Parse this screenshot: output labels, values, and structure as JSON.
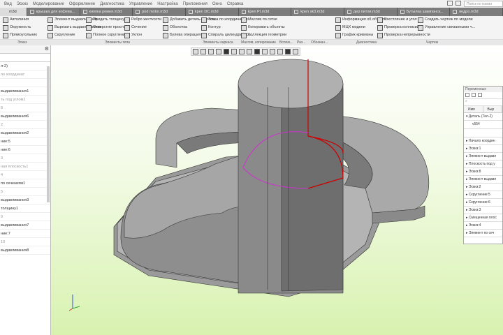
{
  "menu": [
    "Вид",
    "Эскиз",
    "Моделирование",
    "Оформление",
    "Диагностика",
    "Управление",
    "Настройка",
    "Приложения",
    "Окно",
    "Справка"
  ],
  "search_placeholder": "Поиск по коман",
  "tabs": [
    {
      "label": "m3d"
    },
    {
      "label": "крышка для кофева..."
    },
    {
      "label": "кнопка ремня.m3d"
    },
    {
      "label": "pod motor.m3d"
    },
    {
      "label": "kpen DC.m3d"
    },
    {
      "label": "kpen PI.m3d"
    },
    {
      "label": "kpen sk3.m3d"
    },
    {
      "label": "дер питли.m3d"
    },
    {
      "label": "Бутылка шампанск..."
    },
    {
      "label": "ведро.m3d"
    }
  ],
  "ribbon": {
    "sketch": [
      "Автолиния",
      "Окружность",
      "Прямоугольник"
    ],
    "body": [
      "Элемент выдавливания",
      "Вырезать выдавливанием",
      "Скругление",
      "Придать толщину",
      "Отверстие простое",
      "Полное скругление",
      "Ребро жесткости",
      "Сечение",
      "Уклон",
      "Добавить деталь-заготов...",
      "Оболочка",
      "Булева операция"
    ],
    "frame": [
      "Точка по координатам",
      "Контур",
      "Спираль цилиндрическ..."
    ],
    "copy": [
      "Массив по сетке",
      "Копировать объекты",
      "Коллекция геометрии"
    ],
    "diag": [
      "Информация об объекте",
      "МЦХ модели",
      "График кривизны",
      "Расстояние и угол",
      "Проверка коллизий",
      "Проверка непрерывности"
    ],
    "drawing": [
      "Создать чертеж по модели",
      "Управление связанными ч..."
    ]
  },
  "group_labels": [
    "Эскиз",
    "Элементы тела",
    "Элементы каркаса",
    "Массив, копирование",
    "Вспом...",
    "Раз...",
    "Обознач...",
    "Диагностика",
    "Чертеж"
  ],
  "tree": [
    {
      "t": "л-2)",
      "g": false
    },
    {
      "t": "ло координат",
      "g": true
    },
    {
      "t": "",
      "g": false
    },
    {
      "t": "выдавливания1",
      "g": false
    },
    {
      "t": "ть под углом2",
      "g": true
    },
    {
      "t": "8",
      "g": true
    },
    {
      "t": "выдавливания6",
      "g": false
    },
    {
      "t": "2",
      "g": true
    },
    {
      "t": "выдавливания2",
      "g": false
    },
    {
      "t": "ние:5",
      "g": false
    },
    {
      "t": "ние:6",
      "g": false
    },
    {
      "t": "3",
      "g": true
    },
    {
      "t": "ная плоскость1",
      "g": true
    },
    {
      "t": "4",
      "g": true
    },
    {
      "t": "по сечениям1",
      "g": false
    },
    {
      "t": "5",
      "g": true
    },
    {
      "t": "выдавливания3",
      "g": false
    },
    {
      "t": "толщину1",
      "g": false
    },
    {
      "t": "9",
      "g": true
    },
    {
      "t": "выдавливания7",
      "g": false
    },
    {
      "t": "ние:7",
      "g": false
    },
    {
      "t": "10",
      "g": true
    },
    {
      "t": "выдавливания8",
      "g": false
    }
  ],
  "vars": {
    "title": "Переменные",
    "col_name": "Имя",
    "col_expr": "Выр",
    "part": "▾ Деталь (Тел-2)",
    "var": "v554",
    "items": [
      "▸ Начало координ",
      "▸ Эскиз:1",
      "▸ Элемент выдавл",
      "▸ Плоскость под у",
      "▸ Эскиз:8",
      "▸ Элемент выдавл",
      "▸ Эскиз:2",
      "▸ Скругление:5",
      "▸ Скругление:6",
      "▸ Эскиз:3",
      "▸ Смещенная плос",
      "▸ Эскиз:4",
      "▸ Элемент по сеч"
    ]
  },
  "colors": {
    "model": "#8c8c8c",
    "edge_red": "#cc0000",
    "edge_magenta": "#cc33cc"
  }
}
